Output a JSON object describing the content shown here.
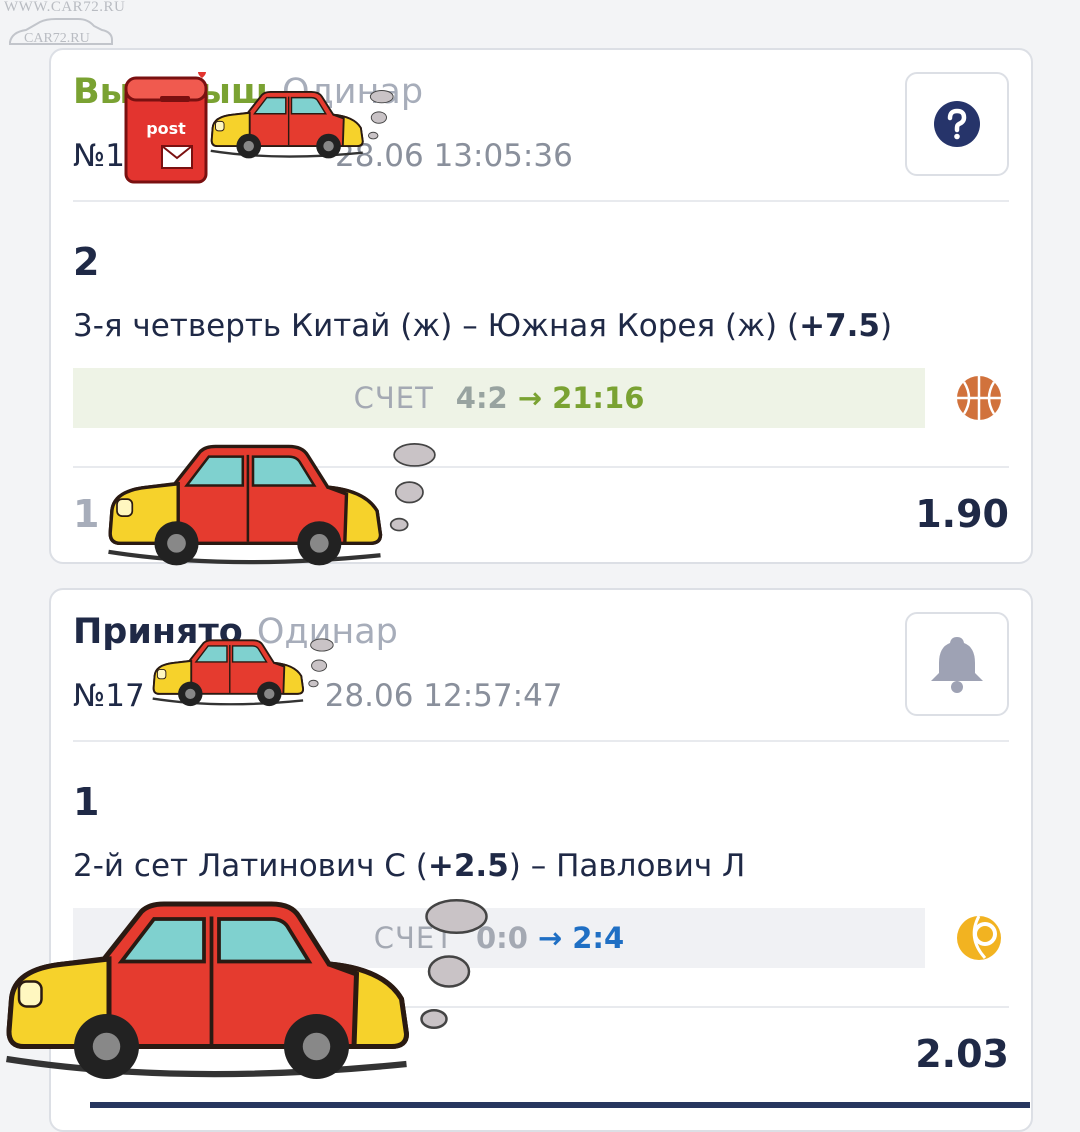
{
  "watermark": {
    "url": "WWW.CAR72.RU",
    "logo": "CAR72.RU"
  },
  "colors": {
    "win": "#7aa232",
    "accepted": "#1f2946",
    "score_blue": "#1f6fc4",
    "muted": "#a7adba"
  },
  "bets": [
    {
      "status": "Выигрыш",
      "type": "Одинар",
      "number": "№1",
      "date": "28.06 13:05:36",
      "status_icon": "question-icon",
      "outcome": "2",
      "market_prefix": "3-я четверть Китай (ж) – Южная Корея (ж) (",
      "handicap": "+7.5",
      "market_suffix": ")",
      "score_label": "СЧЕТ",
      "score_prev": "4:2",
      "score_arrow": "→",
      "score_cur": "21:16",
      "sport_icon": "basketball-icon",
      "stake": "1",
      "odds": "1.90"
    },
    {
      "status": "Принято",
      "type": "Одинар",
      "number": "№17",
      "date": "28.06 12:57:47",
      "status_icon": "bell-icon",
      "outcome": "1",
      "market_prefix": "2-й сет Латинович С (",
      "handicap": "+2.5",
      "market_suffix": ") – Павлович Л",
      "score_label": "СЧЕТ",
      "score_prev": "0:0",
      "score_arrow": "→",
      "score_cur": "2:4",
      "sport_icon": "tennis-ball-icon",
      "stake": "",
      "odds": "2.03"
    }
  ]
}
